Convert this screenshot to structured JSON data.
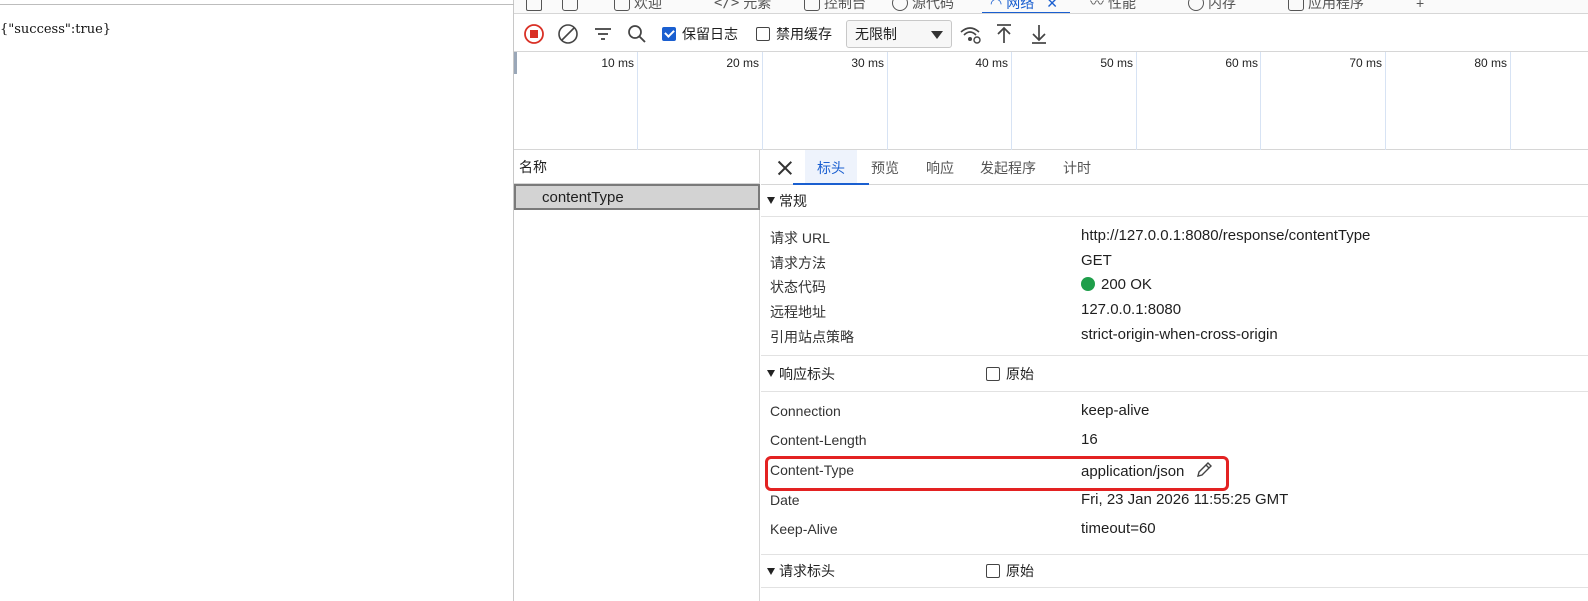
{
  "page": {
    "json_text": "{\"success\":true}"
  },
  "devtools": {
    "panel_tabs": [
      {
        "label": "欢迎",
        "icon": "home-icon"
      },
      {
        "label": "元素",
        "icon": "code-icon"
      },
      {
        "label": "控制台",
        "icon": "console-icon"
      },
      {
        "label": "源代码",
        "icon": "bug-icon"
      },
      {
        "label": "网络",
        "icon": "wifi-icon",
        "active": true
      },
      {
        "label": "性能",
        "icon": "performance-icon"
      },
      {
        "label": "内存",
        "icon": "memory-icon"
      },
      {
        "label": "应用程序",
        "icon": "application-icon"
      }
    ],
    "toolbar": {
      "preserve_log_label": "保留日志",
      "preserve_log_checked": true,
      "disable_cache_label": "禁用缓存",
      "disable_cache_checked": false,
      "throttling_value": "无限制"
    },
    "timeline": {
      "ticks": [
        "10 ms",
        "20 ms",
        "30 ms",
        "40 ms",
        "50 ms",
        "60 ms",
        "70 ms",
        "80 ms"
      ]
    },
    "request_list": {
      "header": "名称",
      "rows": [
        "contentType"
      ]
    },
    "details": {
      "tabs": [
        "标头",
        "预览",
        "响应",
        "发起程序",
        "计时"
      ],
      "active_tab": "标头",
      "general": {
        "title": "常规",
        "rows": [
          {
            "key": "请求 URL",
            "value": "http://127.0.0.1:8080/response/contentType"
          },
          {
            "key": "请求方法",
            "value": "GET"
          },
          {
            "key": "状态代码",
            "value": "200 OK"
          },
          {
            "key": "远程地址",
            "value": "127.0.0.1:8080"
          },
          {
            "key": "引用站点策略",
            "value": "strict-origin-when-cross-origin"
          }
        ]
      },
      "response_headers": {
        "title": "响应标头",
        "raw_label": "原始",
        "rows": [
          {
            "key": "Connection",
            "value": "keep-alive"
          },
          {
            "key": "Content-Length",
            "value": "16"
          },
          {
            "key": "Content-Type",
            "value": "application/json"
          },
          {
            "key": "Date",
            "value": "Fri, 23 Jan 2026 11:55:25 GMT"
          },
          {
            "key": "Keep-Alive",
            "value": "timeout=60"
          }
        ]
      },
      "request_headers": {
        "title": "请求标头",
        "raw_label": "原始"
      }
    },
    "colors": {
      "accent": "#1a5fd0",
      "status_ok": "#1e9e4a",
      "highlight": "#e32222"
    }
  }
}
